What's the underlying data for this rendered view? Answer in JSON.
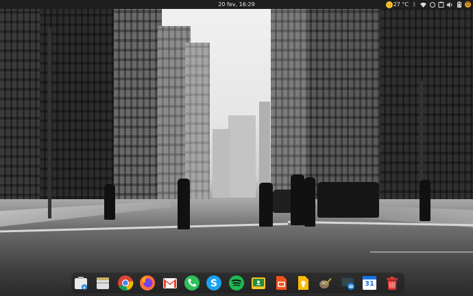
{
  "top_panel": {
    "clock": "20 fev, 16:29",
    "weather_temp": "27 °C",
    "tray_icons": [
      "weather-icon",
      "bluetooth-icon",
      "wifi-icon",
      "whatsapp-tray-icon",
      "clipboard-icon",
      "volume-icon",
      "battery-icon",
      "power-icon"
    ]
  },
  "dock": {
    "items": [
      {
        "name": "files",
        "icon": "file-manager-icon"
      },
      {
        "name": "archive",
        "icon": "archive-manager-icon"
      },
      {
        "name": "chrome",
        "icon": "chrome-icon"
      },
      {
        "name": "firefox",
        "icon": "firefox-icon"
      },
      {
        "name": "gmail",
        "icon": "gmail-icon"
      },
      {
        "name": "phone",
        "icon": "phone-icon"
      },
      {
        "name": "skype",
        "icon": "skype-icon"
      },
      {
        "name": "spotify",
        "icon": "spotify-icon"
      },
      {
        "name": "classroom",
        "icon": "google-classroom-icon"
      },
      {
        "name": "slides",
        "icon": "slides-icon"
      },
      {
        "name": "keep",
        "icon": "keep-icon"
      },
      {
        "name": "gimp",
        "icon": "gimp-icon"
      },
      {
        "name": "screenshot",
        "icon": "screenshot-icon"
      },
      {
        "name": "calendar",
        "icon": "calendar-icon",
        "label": "31"
      },
      {
        "name": "trash",
        "icon": "trash-icon"
      }
    ]
  },
  "colors": {
    "panel_bg": "#1e1e1e",
    "chrome_red": "#db4437",
    "chrome_green": "#0f9d58",
    "chrome_yellow": "#f4b400",
    "chrome_blue": "#4285f4",
    "firefox_orange": "#ff7139",
    "gmail_red": "#ea4335",
    "phone_green": "#2ec05a",
    "skype_blue": "#1da1f2",
    "spotify_green": "#1db954",
    "classroom_green": "#1e8e3e",
    "slides_orange": "#f4511e",
    "keep_yellow": "#fbbc04",
    "calendar_blue": "#1a73e8",
    "trash_red": "#e53935"
  }
}
